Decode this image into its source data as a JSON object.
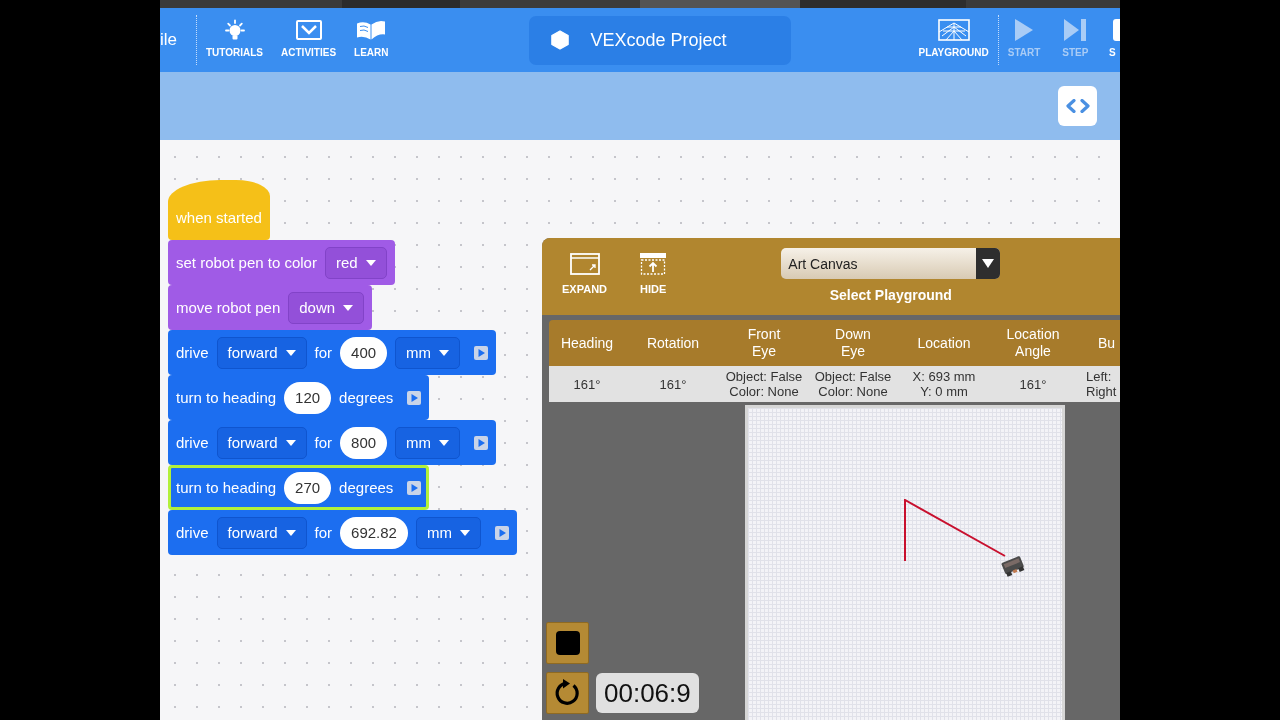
{
  "header": {
    "menu_label": "ile",
    "nav": [
      {
        "kind": "tutorials",
        "label": "TUTORIALS"
      },
      {
        "kind": "activities",
        "label": "ACTIVITIES"
      },
      {
        "kind": "learn",
        "label": "LEARN"
      }
    ],
    "project_title": "VEXcode Project",
    "controls": [
      {
        "kind": "playground",
        "label": "PLAYGROUND",
        "disabled": false
      },
      {
        "kind": "start",
        "label": "START",
        "disabled": true
      },
      {
        "kind": "step",
        "label": "STEP",
        "disabled": true
      },
      {
        "kind": "stop",
        "label": "S",
        "disabled": false
      }
    ]
  },
  "blocks": [
    {
      "kind": "event",
      "active": false,
      "parts": [
        {
          "kind": "text",
          "text": "when started"
        }
      ]
    },
    {
      "kind": "pen",
      "active": false,
      "parts": [
        {
          "kind": "text",
          "text": "set robot pen to color"
        },
        {
          "kind": "dropdown",
          "text": "red"
        }
      ]
    },
    {
      "kind": "pen",
      "active": false,
      "parts": [
        {
          "kind": "text",
          "text": "move robot pen"
        },
        {
          "kind": "dropdown",
          "text": "down"
        }
      ]
    },
    {
      "kind": "motion",
      "active": false,
      "parts": [
        {
          "kind": "text",
          "text": "drive"
        },
        {
          "kind": "dropdown",
          "text": "forward"
        },
        {
          "kind": "text",
          "text": "for"
        },
        {
          "kind": "number",
          "text": "400"
        },
        {
          "kind": "dropdown",
          "text": "mm"
        },
        {
          "kind": "run"
        }
      ]
    },
    {
      "kind": "motion",
      "active": false,
      "parts": [
        {
          "kind": "text",
          "text": "turn to heading"
        },
        {
          "kind": "number",
          "text": "120"
        },
        {
          "kind": "text",
          "text": "degrees"
        },
        {
          "kind": "run"
        }
      ]
    },
    {
      "kind": "motion",
      "active": false,
      "parts": [
        {
          "kind": "text",
          "text": "drive"
        },
        {
          "kind": "dropdown",
          "text": "forward"
        },
        {
          "kind": "text",
          "text": "for"
        },
        {
          "kind": "number",
          "text": "800"
        },
        {
          "kind": "dropdown",
          "text": "mm"
        },
        {
          "kind": "run"
        }
      ]
    },
    {
      "kind": "motion",
      "active": true,
      "parts": [
        {
          "kind": "text",
          "text": "turn to heading"
        },
        {
          "kind": "number",
          "text": "270"
        },
        {
          "kind": "text",
          "text": "degrees"
        },
        {
          "kind": "run"
        }
      ]
    },
    {
      "kind": "motion",
      "active": false,
      "parts": [
        {
          "kind": "text",
          "text": "drive"
        },
        {
          "kind": "dropdown",
          "text": "forward"
        },
        {
          "kind": "text",
          "text": "for"
        },
        {
          "kind": "number",
          "text": "692.82"
        },
        {
          "kind": "dropdown",
          "text": "mm"
        },
        {
          "kind": "run"
        }
      ]
    }
  ],
  "playground": {
    "buttons": [
      {
        "kind": "expand",
        "label": "EXPAND"
      },
      {
        "kind": "hide",
        "label": "HIDE"
      }
    ],
    "selector": {
      "value": "Art Canvas",
      "label": "Select Playground"
    },
    "table": {
      "columns": [
        "Heading",
        "Rotation",
        "Front Eye",
        "Down Eye",
        "Location",
        "Location Angle",
        "Bu"
      ],
      "rows": [
        [
          [
            "161°"
          ],
          [
            "161°"
          ],
          [
            "Object: False",
            "Color: None"
          ],
          [
            "Object: False",
            "Color: None"
          ],
          [
            "X: 693 mm",
            "Y: 0 mm"
          ],
          [
            "161°"
          ],
          [
            "Left:",
            "Right"
          ]
        ]
      ]
    },
    "timer": "00:06:9"
  }
}
